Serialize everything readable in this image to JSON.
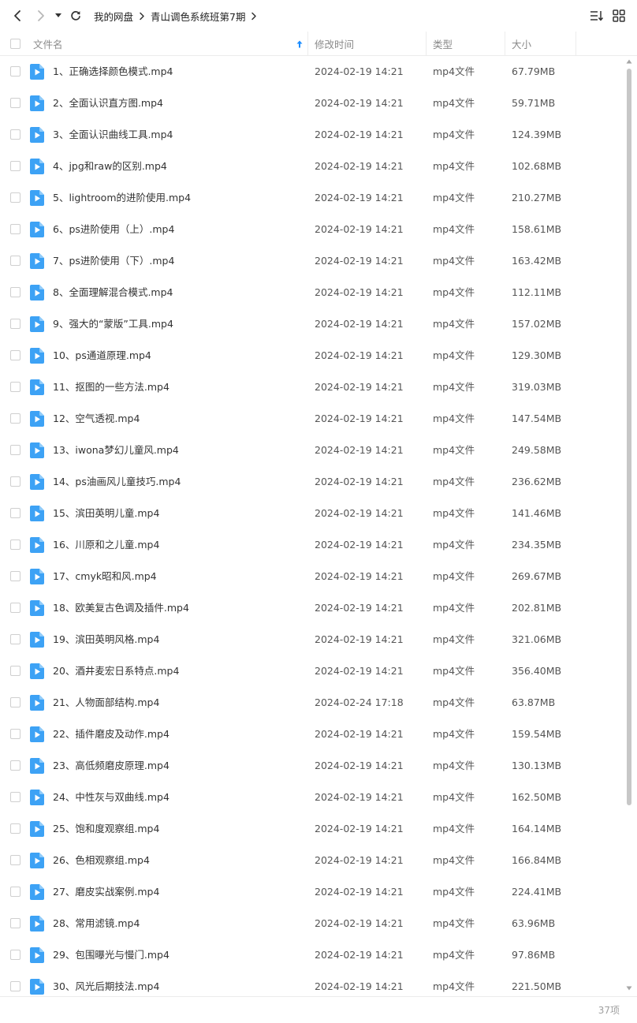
{
  "toolbar": {
    "breadcrumb": [
      "我的网盘",
      "青山调色系统班第7期"
    ]
  },
  "header": {
    "name": "文件名",
    "modified": "修改时间",
    "type": "类型",
    "size": "大小"
  },
  "files": [
    {
      "name": "1、正确选择颜色模式.mp4",
      "date": "2024-02-19 14:21",
      "type": "mp4文件",
      "size": "67.79MB"
    },
    {
      "name": "2、全面认识直方图.mp4",
      "date": "2024-02-19 14:21",
      "type": "mp4文件",
      "size": "59.71MB"
    },
    {
      "name": "3、全面认识曲线工具.mp4",
      "date": "2024-02-19 14:21",
      "type": "mp4文件",
      "size": "124.39MB"
    },
    {
      "name": "4、jpg和raw的区别.mp4",
      "date": "2024-02-19 14:21",
      "type": "mp4文件",
      "size": "102.68MB"
    },
    {
      "name": "5、lightroom的进阶使用.mp4",
      "date": "2024-02-19 14:21",
      "type": "mp4文件",
      "size": "210.27MB"
    },
    {
      "name": "6、ps进阶使用（上）.mp4",
      "date": "2024-02-19 14:21",
      "type": "mp4文件",
      "size": "158.61MB"
    },
    {
      "name": "7、ps进阶使用（下）.mp4",
      "date": "2024-02-19 14:21",
      "type": "mp4文件",
      "size": "163.42MB"
    },
    {
      "name": "8、全面理解混合模式.mp4",
      "date": "2024-02-19 14:21",
      "type": "mp4文件",
      "size": "112.11MB"
    },
    {
      "name": "9、强大的“蒙版”工具.mp4",
      "date": "2024-02-19 14:21",
      "type": "mp4文件",
      "size": "157.02MB"
    },
    {
      "name": "10、ps通道原理.mp4",
      "date": "2024-02-19 14:21",
      "type": "mp4文件",
      "size": "129.30MB"
    },
    {
      "name": "11、抠图的一些方法.mp4",
      "date": "2024-02-19 14:21",
      "type": "mp4文件",
      "size": "319.03MB"
    },
    {
      "name": "12、空气透视.mp4",
      "date": "2024-02-19 14:21",
      "type": "mp4文件",
      "size": "147.54MB"
    },
    {
      "name": "13、iwona梦幻儿童风.mp4",
      "date": "2024-02-19 14:21",
      "type": "mp4文件",
      "size": "249.58MB"
    },
    {
      "name": "14、ps油画风儿童技巧.mp4",
      "date": "2024-02-19 14:21",
      "type": "mp4文件",
      "size": "236.62MB"
    },
    {
      "name": "15、滨田英明儿童.mp4",
      "date": "2024-02-19 14:21",
      "type": "mp4文件",
      "size": "141.46MB"
    },
    {
      "name": "16、川原和之儿童.mp4",
      "date": "2024-02-19 14:21",
      "type": "mp4文件",
      "size": "234.35MB"
    },
    {
      "name": "17、cmyk昭和风.mp4",
      "date": "2024-02-19 14:21",
      "type": "mp4文件",
      "size": "269.67MB"
    },
    {
      "name": "18、欧美复古色调及插件.mp4",
      "date": "2024-02-19 14:21",
      "type": "mp4文件",
      "size": "202.81MB"
    },
    {
      "name": "19、滨田英明风格.mp4",
      "date": "2024-02-19 14:21",
      "type": "mp4文件",
      "size": "321.06MB"
    },
    {
      "name": "20、酒井麦宏日系特点.mp4",
      "date": "2024-02-19 14:21",
      "type": "mp4文件",
      "size": "356.40MB"
    },
    {
      "name": "21、人物面部结构.mp4",
      "date": "2024-02-24 17:18",
      "type": "mp4文件",
      "size": "63.87MB"
    },
    {
      "name": "22、插件磨皮及动作.mp4",
      "date": "2024-02-19 14:21",
      "type": "mp4文件",
      "size": "159.54MB"
    },
    {
      "name": "23、高低频磨皮原理.mp4",
      "date": "2024-02-19 14:21",
      "type": "mp4文件",
      "size": "130.13MB"
    },
    {
      "name": "24、中性灰与双曲线.mp4",
      "date": "2024-02-19 14:21",
      "type": "mp4文件",
      "size": "162.50MB"
    },
    {
      "name": "25、饱和度观察组.mp4",
      "date": "2024-02-19 14:21",
      "type": "mp4文件",
      "size": "164.14MB"
    },
    {
      "name": "26、色相观察组.mp4",
      "date": "2024-02-19 14:21",
      "type": "mp4文件",
      "size": "166.84MB"
    },
    {
      "name": "27、磨皮实战案例.mp4",
      "date": "2024-02-19 14:21",
      "type": "mp4文件",
      "size": "224.41MB"
    },
    {
      "name": "28、常用滤镜.mp4",
      "date": "2024-02-19 14:21",
      "type": "mp4文件",
      "size": "63.96MB"
    },
    {
      "name": "29、包围曝光与慢门.mp4",
      "date": "2024-02-19 14:21",
      "type": "mp4文件",
      "size": "97.86MB"
    },
    {
      "name": "30、风光后期技法.mp4",
      "date": "2024-02-19 14:21",
      "type": "mp4文件",
      "size": "221.50MB"
    }
  ],
  "footer": {
    "count": "37项"
  },
  "colors": {
    "accent": "#1a8cff",
    "file_icon": "#3da2f5",
    "border": "#ececec"
  },
  "icons": {
    "back": "chevron-left-icon",
    "forward": "chevron-right-icon",
    "history": "dropdown-caret-icon",
    "refresh": "refresh-icon",
    "sort": "sort-list-icon",
    "view": "grid-view-icon",
    "file": "video-file-icon"
  }
}
